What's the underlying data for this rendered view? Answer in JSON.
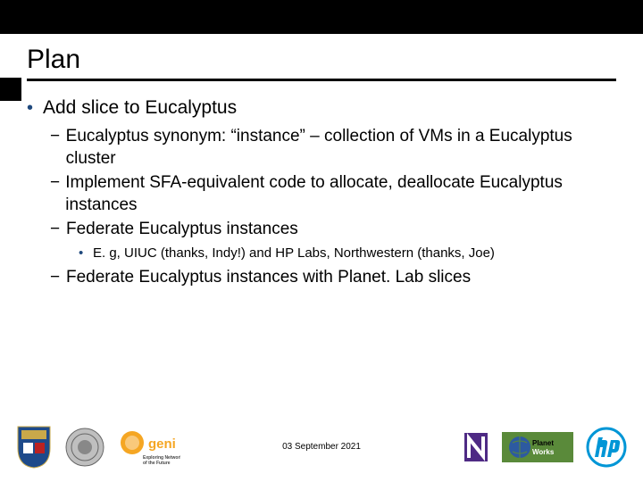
{
  "title": "Plan",
  "bullet_main": "Add slice to Eucalyptus",
  "sub": [
    "Eucalyptus synonym: “instance” – collection of VMs in a Eucalyptus cluster",
    "Implement SFA-equivalent code to allocate, deallocate Eucalyptus instances",
    "Federate Eucalyptus instances"
  ],
  "subsub": "E. g, UIUC (thanks, Indy!) and HP Labs, Northwestern (thanks, Joe)",
  "sub_last": "Federate Eucalyptus instances with Planet. Lab slices",
  "date": "03 September 2021",
  "logos": {
    "left": [
      "shield-crest",
      "seal",
      "geni"
    ],
    "right": [
      "northwestern-n",
      "planetworks",
      "hp"
    ]
  }
}
